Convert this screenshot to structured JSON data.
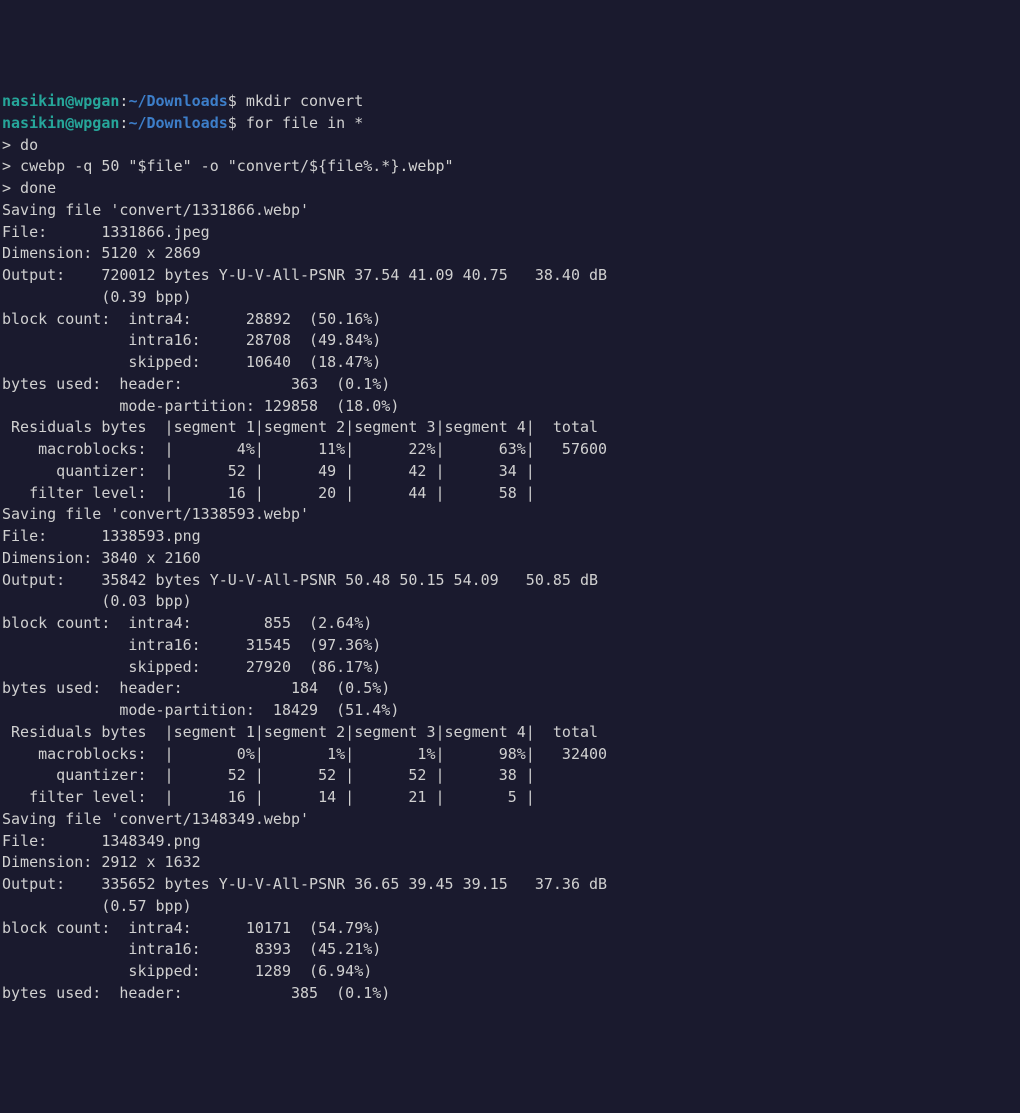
{
  "prompt": {
    "user": "nasikin",
    "at": "@",
    "host": "wpgan",
    "colon": ":",
    "path": "~/Downloads",
    "dollar": "$"
  },
  "commands": {
    "c0": "mkdir convert",
    "c1": "for file in *",
    "c2": "> do",
    "c3": "> cwebp -q 50 \"$file\" -o \"convert/${file%.*}.webp\"",
    "c4": "> done"
  },
  "output": {
    "l00": "Saving file 'convert/1331866.webp'",
    "l01": "File:      1331866.jpeg",
    "l02": "Dimension: 5120 x 2869",
    "l03": "Output:    720012 bytes Y-U-V-All-PSNR 37.54 41.09 40.75   38.40 dB",
    "l04": "           (0.39 bpp)",
    "l05": "block count:  intra4:      28892  (50.16%)",
    "l06": "              intra16:     28708  (49.84%)",
    "l07": "              skipped:     10640  (18.47%)",
    "l08": "bytes used:  header:            363  (0.1%)",
    "l09": "             mode-partition: 129858  (18.0%)",
    "l10": " Residuals bytes  |segment 1|segment 2|segment 3|segment 4|  total",
    "l11": "    macroblocks:  |       4%|      11%|      22%|      63%|   57600",
    "l12": "      quantizer:  |      52 |      49 |      42 |      34 |",
    "l13": "   filter level:  |      16 |      20 |      44 |      58 |",
    "l14": "Saving file 'convert/1338593.webp'",
    "l15": "File:      1338593.png",
    "l16": "Dimension: 3840 x 2160",
    "l17": "Output:    35842 bytes Y-U-V-All-PSNR 50.48 50.15 54.09   50.85 dB",
    "l18": "           (0.03 bpp)",
    "l19": "block count:  intra4:        855  (2.64%)",
    "l20": "              intra16:     31545  (97.36%)",
    "l21": "              skipped:     27920  (86.17%)",
    "l22": "bytes used:  header:            184  (0.5%)",
    "l23": "             mode-partition:  18429  (51.4%)",
    "l24": " Residuals bytes  |segment 1|segment 2|segment 3|segment 4|  total",
    "l25": "    macroblocks:  |       0%|       1%|       1%|      98%|   32400",
    "l26": "      quantizer:  |      52 |      52 |      52 |      38 |",
    "l27": "   filter level:  |      16 |      14 |      21 |       5 |",
    "l28": "Saving file 'convert/1348349.webp'",
    "l29": "File:      1348349.png",
    "l30": "Dimension: 2912 x 1632",
    "l31": "Output:    335652 bytes Y-U-V-All-PSNR 36.65 39.45 39.15   37.36 dB",
    "l32": "           (0.57 bpp)",
    "l33": "block count:  intra4:      10171  (54.79%)",
    "l34": "              intra16:      8393  (45.21%)",
    "l35": "              skipped:      1289  (6.94%)",
    "l36": "bytes used:  header:            385  (0.1%)"
  }
}
